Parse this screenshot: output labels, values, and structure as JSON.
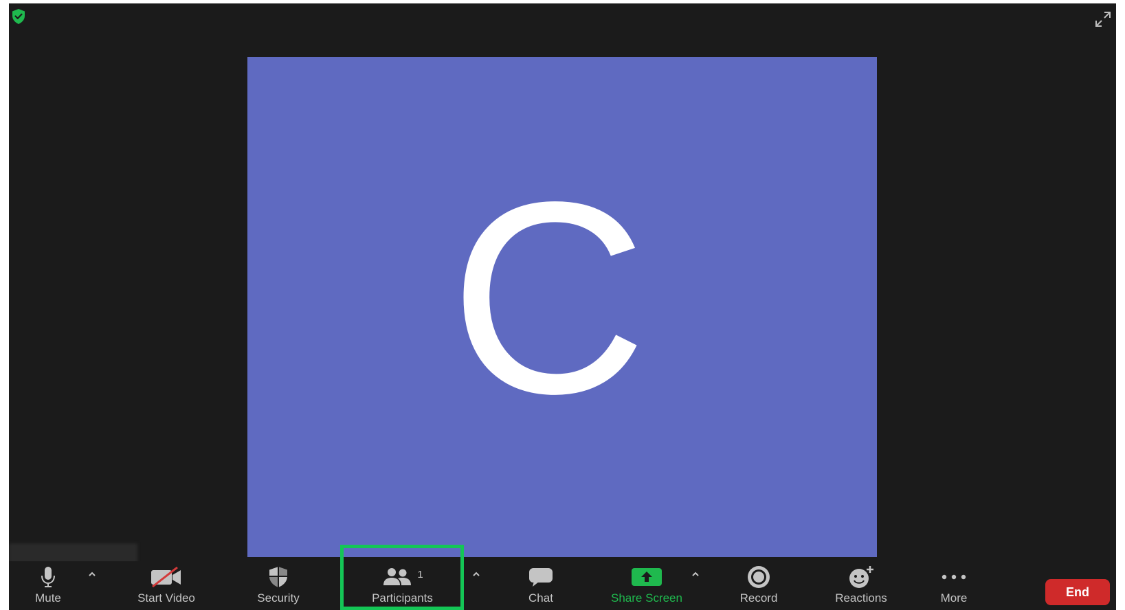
{
  "meeting": {
    "avatar_letter": "C",
    "tile_color": "#5f6ac1",
    "security_badge_icon": "shield-check-icon",
    "fullscreen_icon": "expand-arrows-icon"
  },
  "toolbar": {
    "mute_label": "Mute",
    "start_video_label": "Start Video",
    "security_label": "Security",
    "participants_label": "Participants",
    "participants_count": "1",
    "chat_label": "Chat",
    "share_screen_label": "Share Screen",
    "record_label": "Record",
    "reactions_label": "Reactions",
    "more_label": "More",
    "end_label": "End"
  },
  "colors": {
    "accent_green": "#1fb94e",
    "end_red": "#cf2a2a",
    "highlight_green": "#14c656",
    "background": "#1b1b1b"
  }
}
